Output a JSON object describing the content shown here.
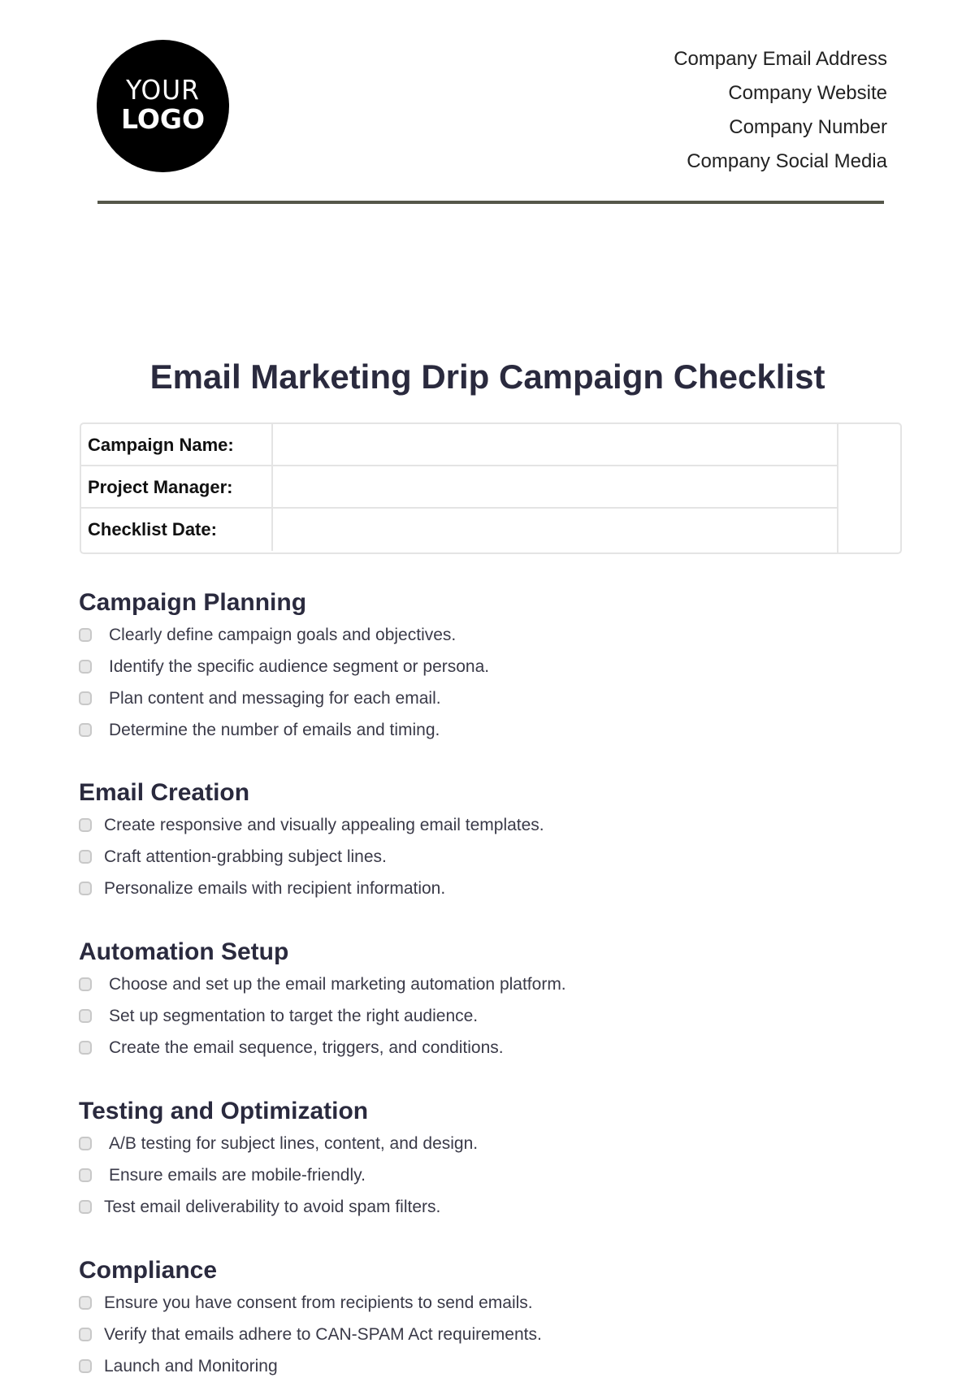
{
  "logo": {
    "line1": "YOUR",
    "line2": "LOGO"
  },
  "contact": [
    "Company Email Address",
    "Company Website",
    "Company Number",
    "Company Social Media"
  ],
  "title": "Email Marketing Drip Campaign Checklist",
  "info_table": [
    {
      "label": "Campaign Name:",
      "value": ""
    },
    {
      "label": "Project Manager:",
      "value": ""
    },
    {
      "label": "Checklist Date:",
      "value": ""
    }
  ],
  "sections": [
    {
      "heading": "Campaign Planning",
      "items": [
        {
          "text": "Clearly define campaign goals and objectives.",
          "checked": false
        },
        {
          "text": "Identify the specific audience segment or persona.",
          "checked": false
        },
        {
          "text": "Plan content and messaging for each email.",
          "checked": false
        },
        {
          "text": "Determine the number of emails and timing.",
          "checked": false
        }
      ]
    },
    {
      "heading": "Email Creation",
      "items": [
        {
          "text": "Create responsive and visually appealing email templates.",
          "checked": false
        },
        {
          "text": "Craft attention-grabbing subject lines.",
          "checked": false
        },
        {
          "text": "Personalize emails with recipient information.",
          "checked": false
        }
      ]
    },
    {
      "heading": "Automation Setup",
      "items": [
        {
          "text": "Choose and set up the email marketing automation platform.",
          "checked": false
        },
        {
          "text": "Set up segmentation to target the right audience.",
          "checked": false
        },
        {
          "text": "Create the email sequence, triggers, and conditions.",
          "checked": false
        }
      ]
    },
    {
      "heading": "Testing and Optimization",
      "items": [
        {
          "text": "A/B testing for subject lines, content, and design.",
          "checked": false
        },
        {
          "text": "Ensure emails are mobile-friendly.",
          "checked": false
        },
        {
          "text": "Test email deliverability to avoid spam filters.",
          "checked": false
        }
      ]
    },
    {
      "heading": "Compliance",
      "items": [
        {
          "text": "Ensure you have consent from recipients to send emails.",
          "checked": false
        },
        {
          "text": "Verify that emails adhere to CAN-SPAM Act requirements.",
          "checked": false
        },
        {
          "text": "Launch and Monitoring",
          "checked": false
        }
      ]
    }
  ]
}
